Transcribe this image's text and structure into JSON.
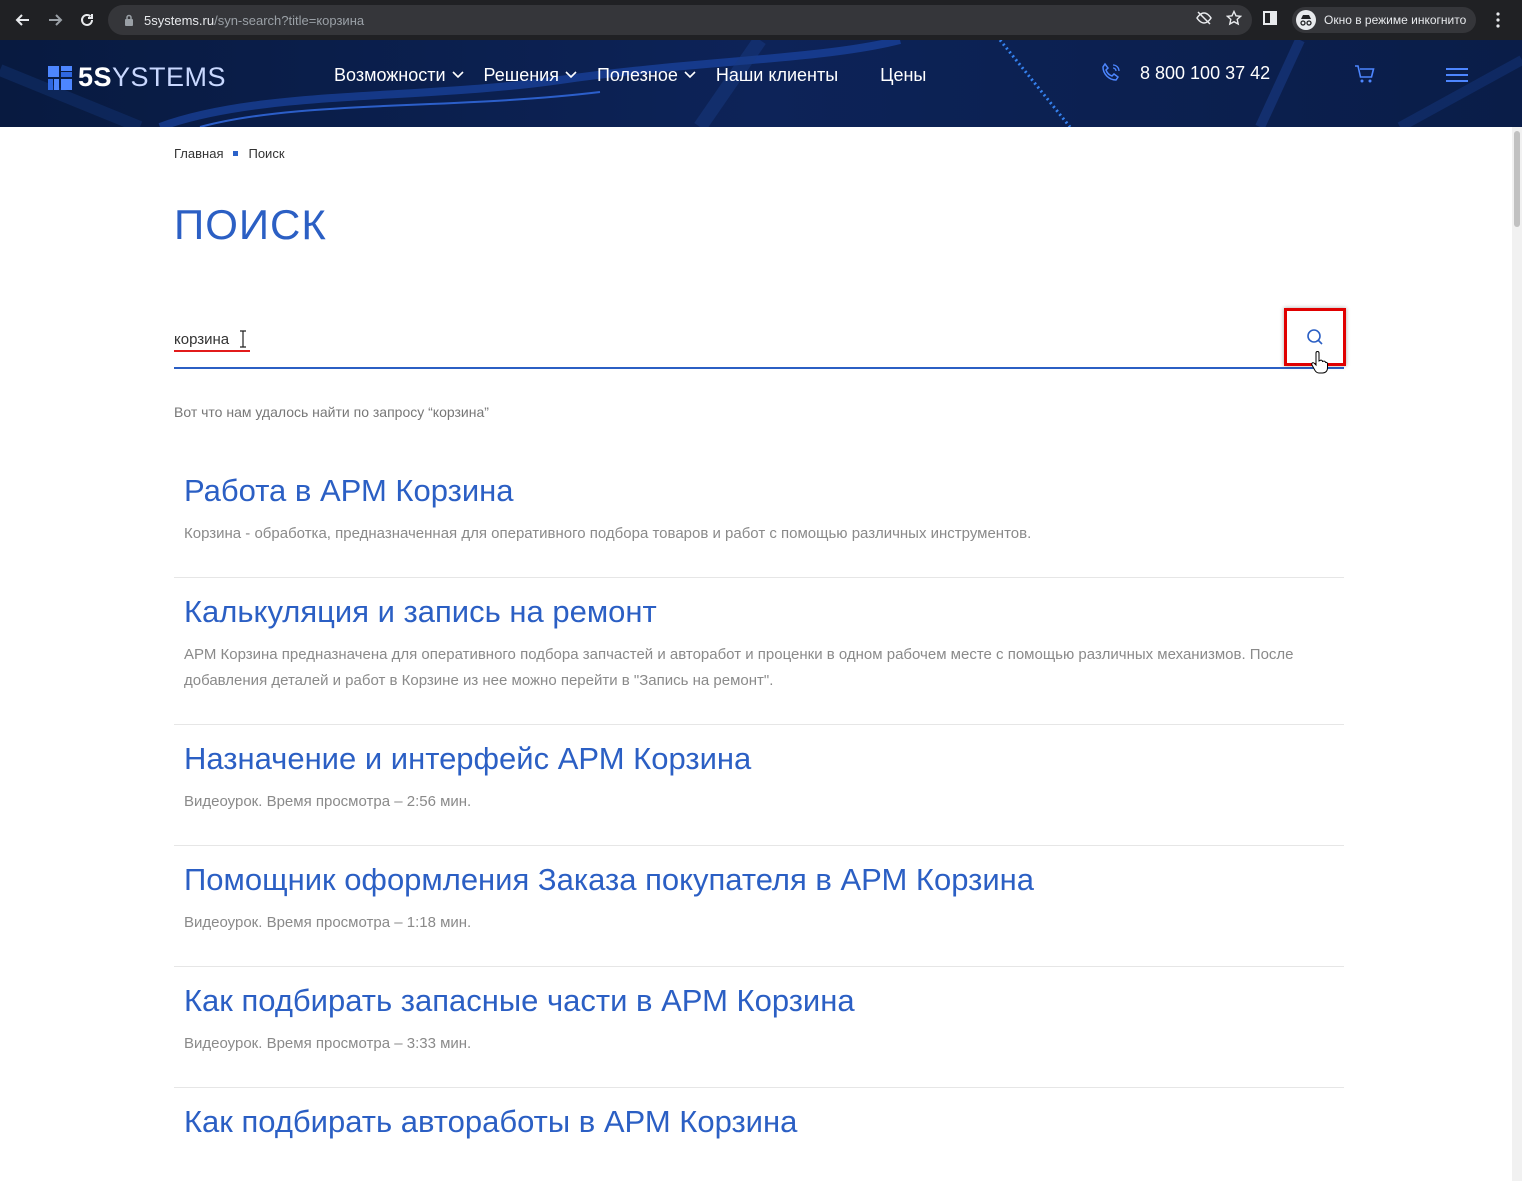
{
  "browser": {
    "url_host": "5systems.ru",
    "url_path": "/syn-search?title=корзина",
    "incognito_label": "Окно в режиме инкогнито"
  },
  "header": {
    "logo_bold": "5S",
    "logo_thin": "YSTEMS",
    "nav": [
      {
        "label": "Возможности",
        "has_dropdown": true
      },
      {
        "label": "Решения",
        "has_dropdown": true
      },
      {
        "label": "Полезное",
        "has_dropdown": true
      },
      {
        "label": "Наши клиенты",
        "has_dropdown": false
      },
      {
        "label": "Цены",
        "has_dropdown": false
      }
    ],
    "phone": "8 800 100 37 42"
  },
  "breadcrumb": {
    "home": "Главная",
    "current": "Поиск"
  },
  "page": {
    "title": "ПОИСК",
    "search_value": "корзина",
    "results_caption": "Вот что нам удалось найти по запросу “корзина”"
  },
  "results": [
    {
      "title": "Работа в АРМ Корзина",
      "desc": "Корзина - обработка, предназначенная для оперативного подбора товаров и работ с помощью различных инструментов."
    },
    {
      "title": "Калькуляция и запись на ремонт",
      "desc": "АРМ Корзина предназначена для оперативного подбора запчастей и авторабот и проценки в одном рабочем месте с помощью различных механизмов. После добавления деталей и работ в Корзине из нее можно перейти в \"Запись на ремонт\"."
    },
    {
      "title": "Назначение и интерфейс АРМ Корзина",
      "desc": "Видеоурок. Время просмотра – 2:56 мин."
    },
    {
      "title": "Помощник оформления Заказа покупателя в АРМ Корзина",
      "desc": "Видеоурок. Время просмотра – 1:18 мин."
    },
    {
      "title": "Как подбирать запасные части в АРМ Корзина",
      "desc": "Видеоурок. Время просмотра – 3:33 мин."
    },
    {
      "title": "Как подбирать автоработы в АРМ Корзина",
      "desc": ""
    }
  ],
  "colors": {
    "brand_blue": "#2b5fc4",
    "header_bg": "#0b1f4a",
    "highlight_red": "#e00000"
  }
}
